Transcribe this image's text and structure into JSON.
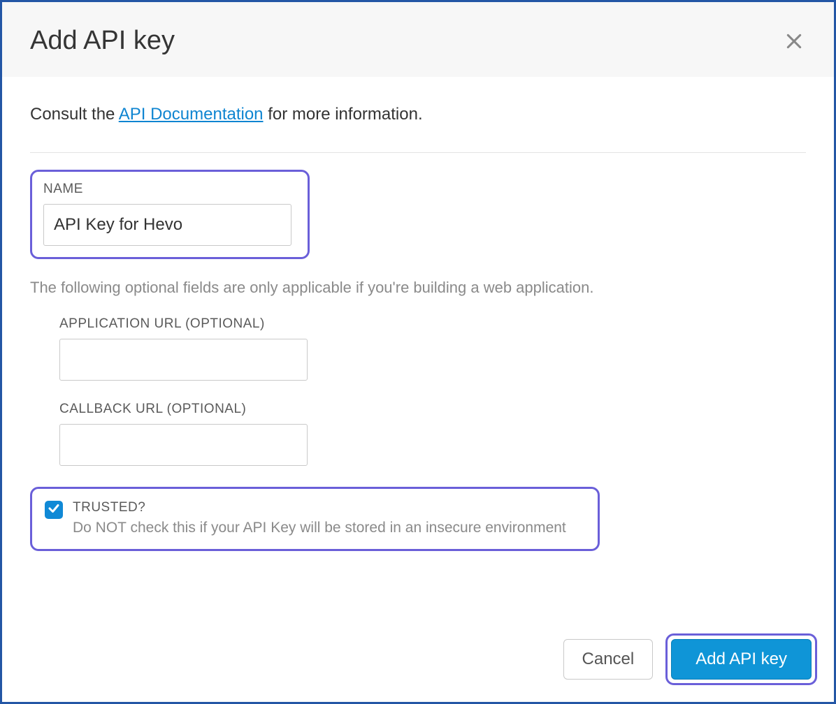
{
  "header": {
    "title": "Add API key"
  },
  "consult": {
    "prefix": "Consult the ",
    "link_text": "API Documentation",
    "suffix": " for more information."
  },
  "form": {
    "name": {
      "label": "NAME",
      "value": "API Key for Hevo"
    },
    "hint": "The following optional fields are only applicable if you're building a web application.",
    "app_url": {
      "label": "APPLICATION URL (OPTIONAL)",
      "value": ""
    },
    "callback_url": {
      "label": "CALLBACK URL (OPTIONAL)",
      "value": ""
    },
    "trusted": {
      "label": "TRUSTED?",
      "description": "Do NOT check this if your API Key will be stored in an insecure environment",
      "checked": true
    }
  },
  "footer": {
    "cancel_label": "Cancel",
    "submit_label": "Add API key"
  }
}
